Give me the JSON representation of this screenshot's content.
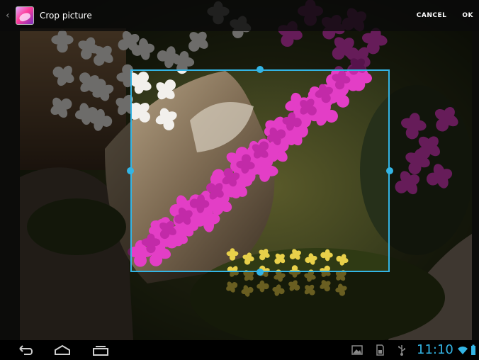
{
  "action_bar": {
    "title": "Crop picture",
    "cancel_label": "CANCEL",
    "ok_label": "OK",
    "app_icon": "gallery-icon",
    "up_icon": "up-caret-icon"
  },
  "status_bar": {
    "time": "11:10",
    "notification_icons": [
      "picture-icon",
      "sd-card-icon",
      "usb-icon"
    ],
    "wifi_icon": "wifi-icon",
    "battery_icon": "battery-icon"
  },
  "navigation": {
    "back_icon": "back-icon",
    "home_icon": "home-icon",
    "recents_icon": "recents-icon"
  },
  "colors": {
    "accent": "#33b5e5",
    "action_bar_bg": "#111111",
    "orchid": "#e040c8"
  }
}
